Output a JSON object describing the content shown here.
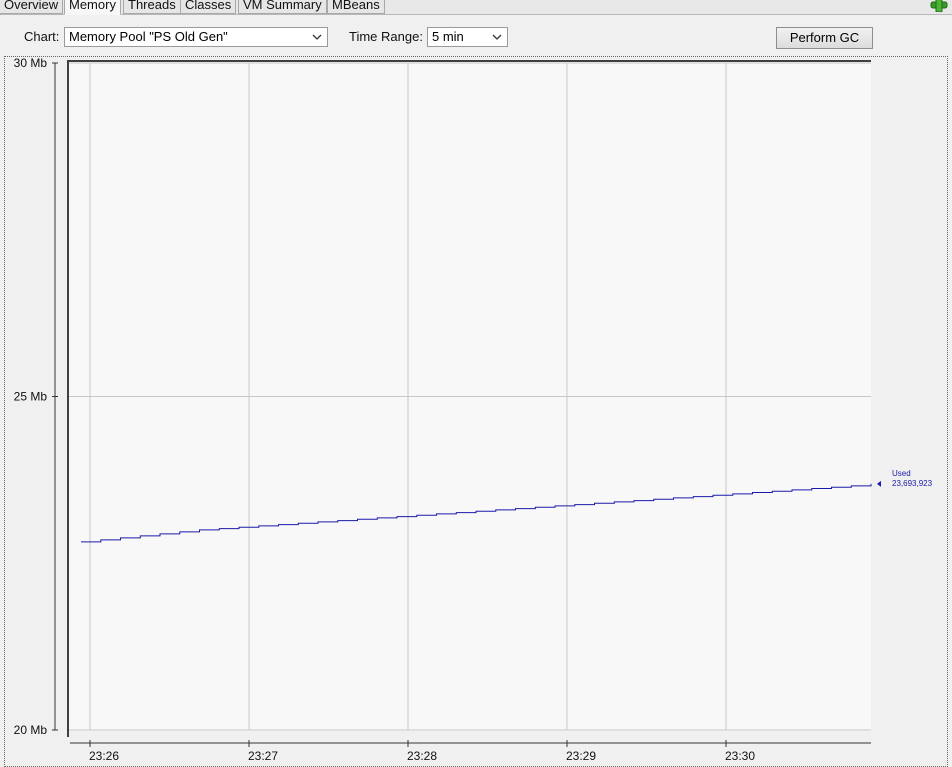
{
  "tabs": [
    {
      "label": "Overview",
      "active": false
    },
    {
      "label": "Memory",
      "active": true
    },
    {
      "label": "Threads",
      "active": false
    },
    {
      "label": "Classes",
      "active": false
    },
    {
      "label": "VM Summary",
      "active": false
    },
    {
      "label": "MBeans",
      "active": false
    }
  ],
  "toolbar": {
    "chart_label": "Chart:",
    "chart_value": "Memory Pool \"PS Old Gen\"",
    "time_range_label": "Time Range:",
    "time_range_value": "5 min",
    "gc_button": "Perform GC"
  },
  "colors": {
    "series": "#1a1aa8",
    "grid": "#c8c8c8",
    "plot_bg": "#f8f8f8"
  },
  "icons": {
    "connection": "connection-plug-icon",
    "dropdown": "chevron-down-icon"
  },
  "chart_data": {
    "type": "line",
    "ylim": [
      20,
      30
    ],
    "y_ticks": [
      {
        "value": 30,
        "label": "30 Mb"
      },
      {
        "value": 25,
        "label": "25 Mb"
      },
      {
        "value": 20,
        "label": "20 Mb"
      }
    ],
    "x_ticks": [
      "23:26",
      "23:27",
      "23:28",
      "23:29",
      "23:30"
    ],
    "grid": true,
    "series": [
      {
        "name": "Used",
        "current_value_label": "23,693,923",
        "values": [
          22.82,
          22.85,
          22.88,
          22.91,
          22.94,
          22.97,
          23.0,
          23.02,
          23.04,
          23.06,
          23.08,
          23.1,
          23.12,
          23.14,
          23.16,
          23.18,
          23.2,
          23.22,
          23.24,
          23.26,
          23.28,
          23.3,
          23.32,
          23.34,
          23.36,
          23.38,
          23.4,
          23.42,
          23.44,
          23.46,
          23.48,
          23.5,
          23.52,
          23.54,
          23.56,
          23.58,
          23.6,
          23.62,
          23.64,
          23.66,
          23.69
        ]
      }
    ],
    "legend": "right"
  }
}
